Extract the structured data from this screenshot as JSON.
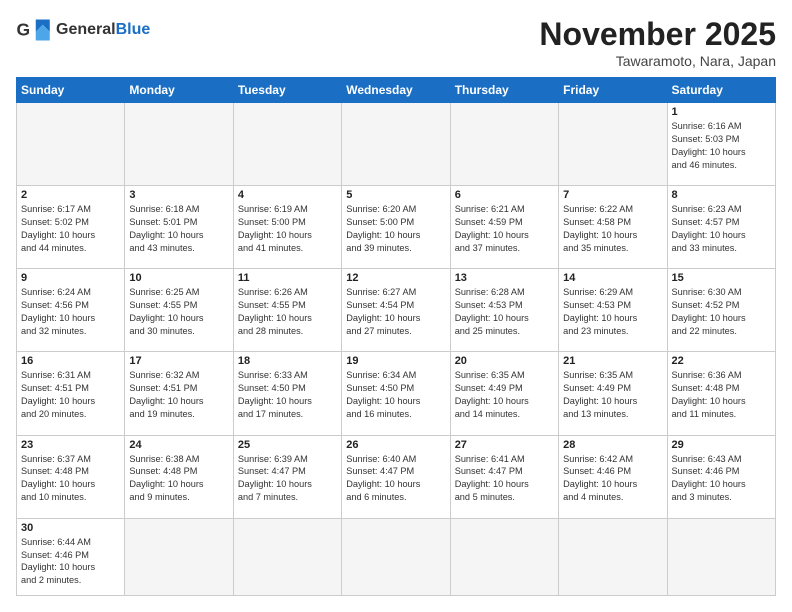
{
  "header": {
    "logo_general": "General",
    "logo_blue": "Blue",
    "month_title": "November 2025",
    "subtitle": "Tawaramoto, Nara, Japan"
  },
  "days_of_week": [
    "Sunday",
    "Monday",
    "Tuesday",
    "Wednesday",
    "Thursday",
    "Friday",
    "Saturday"
  ],
  "weeks": [
    [
      {
        "day": "",
        "info": ""
      },
      {
        "day": "",
        "info": ""
      },
      {
        "day": "",
        "info": ""
      },
      {
        "day": "",
        "info": ""
      },
      {
        "day": "",
        "info": ""
      },
      {
        "day": "",
        "info": ""
      },
      {
        "day": "1",
        "info": "Sunrise: 6:16 AM\nSunset: 5:03 PM\nDaylight: 10 hours\nand 46 minutes."
      }
    ],
    [
      {
        "day": "2",
        "info": "Sunrise: 6:17 AM\nSunset: 5:02 PM\nDaylight: 10 hours\nand 44 minutes."
      },
      {
        "day": "3",
        "info": "Sunrise: 6:18 AM\nSunset: 5:01 PM\nDaylight: 10 hours\nand 43 minutes."
      },
      {
        "day": "4",
        "info": "Sunrise: 6:19 AM\nSunset: 5:00 PM\nDaylight: 10 hours\nand 41 minutes."
      },
      {
        "day": "5",
        "info": "Sunrise: 6:20 AM\nSunset: 5:00 PM\nDaylight: 10 hours\nand 39 minutes."
      },
      {
        "day": "6",
        "info": "Sunrise: 6:21 AM\nSunset: 4:59 PM\nDaylight: 10 hours\nand 37 minutes."
      },
      {
        "day": "7",
        "info": "Sunrise: 6:22 AM\nSunset: 4:58 PM\nDaylight: 10 hours\nand 35 minutes."
      },
      {
        "day": "8",
        "info": "Sunrise: 6:23 AM\nSunset: 4:57 PM\nDaylight: 10 hours\nand 33 minutes."
      }
    ],
    [
      {
        "day": "9",
        "info": "Sunrise: 6:24 AM\nSunset: 4:56 PM\nDaylight: 10 hours\nand 32 minutes."
      },
      {
        "day": "10",
        "info": "Sunrise: 6:25 AM\nSunset: 4:55 PM\nDaylight: 10 hours\nand 30 minutes."
      },
      {
        "day": "11",
        "info": "Sunrise: 6:26 AM\nSunset: 4:55 PM\nDaylight: 10 hours\nand 28 minutes."
      },
      {
        "day": "12",
        "info": "Sunrise: 6:27 AM\nSunset: 4:54 PM\nDaylight: 10 hours\nand 27 minutes."
      },
      {
        "day": "13",
        "info": "Sunrise: 6:28 AM\nSunset: 4:53 PM\nDaylight: 10 hours\nand 25 minutes."
      },
      {
        "day": "14",
        "info": "Sunrise: 6:29 AM\nSunset: 4:53 PM\nDaylight: 10 hours\nand 23 minutes."
      },
      {
        "day": "15",
        "info": "Sunrise: 6:30 AM\nSunset: 4:52 PM\nDaylight: 10 hours\nand 22 minutes."
      }
    ],
    [
      {
        "day": "16",
        "info": "Sunrise: 6:31 AM\nSunset: 4:51 PM\nDaylight: 10 hours\nand 20 minutes."
      },
      {
        "day": "17",
        "info": "Sunrise: 6:32 AM\nSunset: 4:51 PM\nDaylight: 10 hours\nand 19 minutes."
      },
      {
        "day": "18",
        "info": "Sunrise: 6:33 AM\nSunset: 4:50 PM\nDaylight: 10 hours\nand 17 minutes."
      },
      {
        "day": "19",
        "info": "Sunrise: 6:34 AM\nSunset: 4:50 PM\nDaylight: 10 hours\nand 16 minutes."
      },
      {
        "day": "20",
        "info": "Sunrise: 6:35 AM\nSunset: 4:49 PM\nDaylight: 10 hours\nand 14 minutes."
      },
      {
        "day": "21",
        "info": "Sunrise: 6:35 AM\nSunset: 4:49 PM\nDaylight: 10 hours\nand 13 minutes."
      },
      {
        "day": "22",
        "info": "Sunrise: 6:36 AM\nSunset: 4:48 PM\nDaylight: 10 hours\nand 11 minutes."
      }
    ],
    [
      {
        "day": "23",
        "info": "Sunrise: 6:37 AM\nSunset: 4:48 PM\nDaylight: 10 hours\nand 10 minutes."
      },
      {
        "day": "24",
        "info": "Sunrise: 6:38 AM\nSunset: 4:48 PM\nDaylight: 10 hours\nand 9 minutes."
      },
      {
        "day": "25",
        "info": "Sunrise: 6:39 AM\nSunset: 4:47 PM\nDaylight: 10 hours\nand 7 minutes."
      },
      {
        "day": "26",
        "info": "Sunrise: 6:40 AM\nSunset: 4:47 PM\nDaylight: 10 hours\nand 6 minutes."
      },
      {
        "day": "27",
        "info": "Sunrise: 6:41 AM\nSunset: 4:47 PM\nDaylight: 10 hours\nand 5 minutes."
      },
      {
        "day": "28",
        "info": "Sunrise: 6:42 AM\nSunset: 4:46 PM\nDaylight: 10 hours\nand 4 minutes."
      },
      {
        "day": "29",
        "info": "Sunrise: 6:43 AM\nSunset: 4:46 PM\nDaylight: 10 hours\nand 3 minutes."
      }
    ],
    [
      {
        "day": "30",
        "info": "Sunrise: 6:44 AM\nSunset: 4:46 PM\nDaylight: 10 hours\nand 2 minutes."
      },
      {
        "day": "",
        "info": ""
      },
      {
        "day": "",
        "info": ""
      },
      {
        "day": "",
        "info": ""
      },
      {
        "day": "",
        "info": ""
      },
      {
        "day": "",
        "info": ""
      },
      {
        "day": "",
        "info": ""
      }
    ]
  ]
}
